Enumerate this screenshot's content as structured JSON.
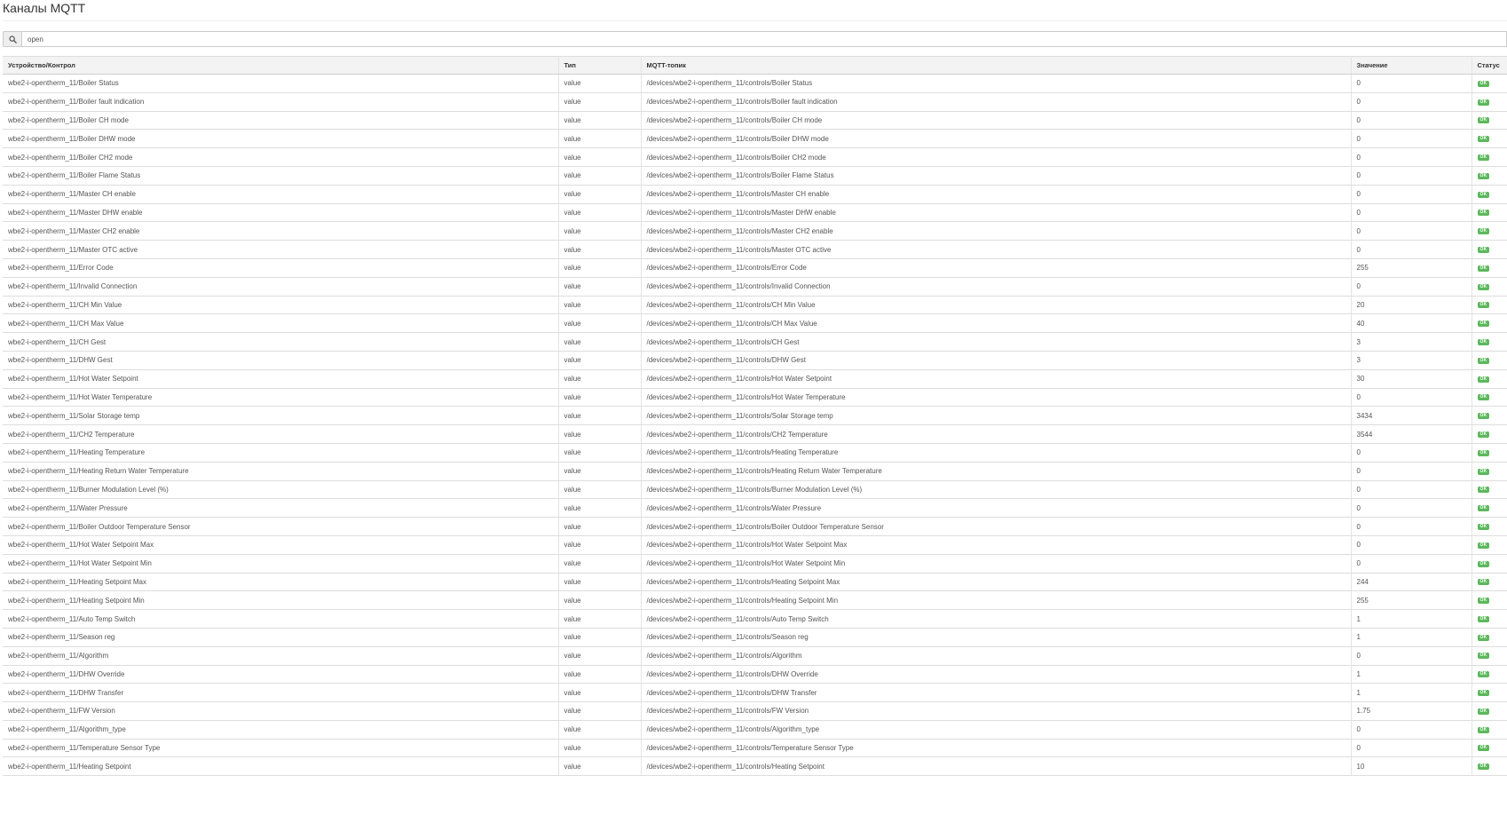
{
  "page": {
    "title": "Каналы MQTT"
  },
  "search": {
    "value": "open",
    "icon": "search-icon"
  },
  "table": {
    "headers": {
      "device": "Устройство/Контрол",
      "type": "Тип",
      "topic": "MQTT-топик",
      "value": "Значение",
      "status": "Статус"
    },
    "status_color": "#5cb85c",
    "rows": [
      {
        "device": "wbe2-i-opentherm_11/Boiler Status",
        "type": "value",
        "topic": "/devices/wbe2-i-opentherm_11/controls/Boiler Status",
        "value": "0",
        "status": "OK"
      },
      {
        "device": "wbe2-i-opentherm_11/Boiler fault indication",
        "type": "value",
        "topic": "/devices/wbe2-i-opentherm_11/controls/Boiler fault indication",
        "value": "0",
        "status": "OK"
      },
      {
        "device": "wbe2-i-opentherm_11/Boiler CH mode",
        "type": "value",
        "topic": "/devices/wbe2-i-opentherm_11/controls/Boiler CH mode",
        "value": "0",
        "status": "OK"
      },
      {
        "device": "wbe2-i-opentherm_11/Boiler DHW mode",
        "type": "value",
        "topic": "/devices/wbe2-i-opentherm_11/controls/Boiler DHW mode",
        "value": "0",
        "status": "OK"
      },
      {
        "device": "wbe2-i-opentherm_11/Boiler CH2 mode",
        "type": "value",
        "topic": "/devices/wbe2-i-opentherm_11/controls/Boiler CH2 mode",
        "value": "0",
        "status": "OK"
      },
      {
        "device": "wbe2-i-opentherm_11/Boiler Flame Status",
        "type": "value",
        "topic": "/devices/wbe2-i-opentherm_11/controls/Boiler Flame Status",
        "value": "0",
        "status": "OK"
      },
      {
        "device": "wbe2-i-opentherm_11/Master CH enable",
        "type": "value",
        "topic": "/devices/wbe2-i-opentherm_11/controls/Master CH enable",
        "value": "0",
        "status": "OK"
      },
      {
        "device": "wbe2-i-opentherm_11/Master DHW enable",
        "type": "value",
        "topic": "/devices/wbe2-i-opentherm_11/controls/Master DHW enable",
        "value": "0",
        "status": "OK"
      },
      {
        "device": "wbe2-i-opentherm_11/Master CH2 enable",
        "type": "value",
        "topic": "/devices/wbe2-i-opentherm_11/controls/Master CH2 enable",
        "value": "0",
        "status": "OK"
      },
      {
        "device": "wbe2-i-opentherm_11/Master OTC active",
        "type": "value",
        "topic": "/devices/wbe2-i-opentherm_11/controls/Master OTC active",
        "value": "0",
        "status": "OK"
      },
      {
        "device": "wbe2-i-opentherm_11/Error Code",
        "type": "value",
        "topic": "/devices/wbe2-i-opentherm_11/controls/Error Code",
        "value": "255",
        "status": "OK"
      },
      {
        "device": "wbe2-i-opentherm_11/Invalid Connection",
        "type": "value",
        "topic": "/devices/wbe2-i-opentherm_11/controls/Invalid Connection",
        "value": "0",
        "status": "OK"
      },
      {
        "device": "wbe2-i-opentherm_11/CH Min Value",
        "type": "value",
        "topic": "/devices/wbe2-i-opentherm_11/controls/CH Min Value",
        "value": "20",
        "status": "OK"
      },
      {
        "device": "wbe2-i-opentherm_11/CH Max Value",
        "type": "value",
        "topic": "/devices/wbe2-i-opentherm_11/controls/CH Max Value",
        "value": "40",
        "status": "OK"
      },
      {
        "device": "wbe2-i-opentherm_11/CH Gest",
        "type": "value",
        "topic": "/devices/wbe2-i-opentherm_11/controls/CH Gest",
        "value": "3",
        "status": "OK"
      },
      {
        "device": "wbe2-i-opentherm_11/DHW Gest",
        "type": "value",
        "topic": "/devices/wbe2-i-opentherm_11/controls/DHW Gest",
        "value": "3",
        "status": "OK"
      },
      {
        "device": "wbe2-i-opentherm_11/Hot Water Setpoint",
        "type": "value",
        "topic": "/devices/wbe2-i-opentherm_11/controls/Hot Water Setpoint",
        "value": "30",
        "status": "OK"
      },
      {
        "device": "wbe2-i-opentherm_11/Hot Water Temperature",
        "type": "value",
        "topic": "/devices/wbe2-i-opentherm_11/controls/Hot Water Temperature",
        "value": "0",
        "status": "OK"
      },
      {
        "device": "wbe2-i-opentherm_11/Solar Storage temp",
        "type": "value",
        "topic": "/devices/wbe2-i-opentherm_11/controls/Solar Storage temp",
        "value": "3434",
        "status": "OK"
      },
      {
        "device": "wbe2-i-opentherm_11/CH2 Temperature",
        "type": "value",
        "topic": "/devices/wbe2-i-opentherm_11/controls/CH2 Temperature",
        "value": "3544",
        "status": "OK"
      },
      {
        "device": "wbe2-i-opentherm_11/Heating Temperature",
        "type": "value",
        "topic": "/devices/wbe2-i-opentherm_11/controls/Heating Temperature",
        "value": "0",
        "status": "OK"
      },
      {
        "device": "wbe2-i-opentherm_11/Heating Return Water Temperature",
        "type": "value",
        "topic": "/devices/wbe2-i-opentherm_11/controls/Heating Return Water Temperature",
        "value": "0",
        "status": "OK"
      },
      {
        "device": "wbe2-i-opentherm_11/Burner Modulation Level (%)",
        "type": "value",
        "topic": "/devices/wbe2-i-opentherm_11/controls/Burner Modulation Level (%)",
        "value": "0",
        "status": "OK"
      },
      {
        "device": "wbe2-i-opentherm_11/Water Pressure",
        "type": "value",
        "topic": "/devices/wbe2-i-opentherm_11/controls/Water Pressure",
        "value": "0",
        "status": "OK"
      },
      {
        "device": "wbe2-i-opentherm_11/Boiler Outdoor Temperature Sensor",
        "type": "value",
        "topic": "/devices/wbe2-i-opentherm_11/controls/Boiler Outdoor Temperature Sensor",
        "value": "0",
        "status": "OK"
      },
      {
        "device": "wbe2-i-opentherm_11/Hot Water Setpoint Max",
        "type": "value",
        "topic": "/devices/wbe2-i-opentherm_11/controls/Hot Water Setpoint Max",
        "value": "0",
        "status": "OK"
      },
      {
        "device": "wbe2-i-opentherm_11/Hot Water Setpoint Min",
        "type": "value",
        "topic": "/devices/wbe2-i-opentherm_11/controls/Hot Water Setpoint Min",
        "value": "0",
        "status": "OK"
      },
      {
        "device": "wbe2-i-opentherm_11/Heating Setpoint Max",
        "type": "value",
        "topic": "/devices/wbe2-i-opentherm_11/controls/Heating Setpoint Max",
        "value": "244",
        "status": "OK"
      },
      {
        "device": "wbe2-i-opentherm_11/Heating Setpoint Min",
        "type": "value",
        "topic": "/devices/wbe2-i-opentherm_11/controls/Heating Setpoint Min",
        "value": "255",
        "status": "OK"
      },
      {
        "device": "wbe2-i-opentherm_11/Auto Temp Switch",
        "type": "value",
        "topic": "/devices/wbe2-i-opentherm_11/controls/Auto Temp Switch",
        "value": "1",
        "status": "OK"
      },
      {
        "device": "wbe2-i-opentherm_11/Season reg",
        "type": "value",
        "topic": "/devices/wbe2-i-opentherm_11/controls/Season reg",
        "value": "1",
        "status": "OK"
      },
      {
        "device": "wbe2-i-opentherm_11/Algorithm",
        "type": "value",
        "topic": "/devices/wbe2-i-opentherm_11/controls/Algorithm",
        "value": "0",
        "status": "OK"
      },
      {
        "device": "wbe2-i-opentherm_11/DHW Override",
        "type": "value",
        "topic": "/devices/wbe2-i-opentherm_11/controls/DHW Override",
        "value": "1",
        "status": "OK"
      },
      {
        "device": "wbe2-i-opentherm_11/DHW Transfer",
        "type": "value",
        "topic": "/devices/wbe2-i-opentherm_11/controls/DHW Transfer",
        "value": "1",
        "status": "OK"
      },
      {
        "device": "wbe2-i-opentherm_11/FW Version",
        "type": "value",
        "topic": "/devices/wbe2-i-opentherm_11/controls/FW Version",
        "value": "1.75",
        "status": "OK"
      },
      {
        "device": "wbe2-i-opentherm_11/Algorithm_type",
        "type": "value",
        "topic": "/devices/wbe2-i-opentherm_11/controls/Algorithm_type",
        "value": "0",
        "status": "OK"
      },
      {
        "device": "wbe2-i-opentherm_11/Temperature Sensor Type",
        "type": "value",
        "topic": "/devices/wbe2-i-opentherm_11/controls/Temperature Sensor Type",
        "value": "0",
        "status": "OK"
      },
      {
        "device": "wbe2-i-opentherm_11/Heating Setpoint",
        "type": "value",
        "topic": "/devices/wbe2-i-opentherm_11/controls/Heating Setpoint",
        "value": "10",
        "status": "OK"
      }
    ]
  }
}
